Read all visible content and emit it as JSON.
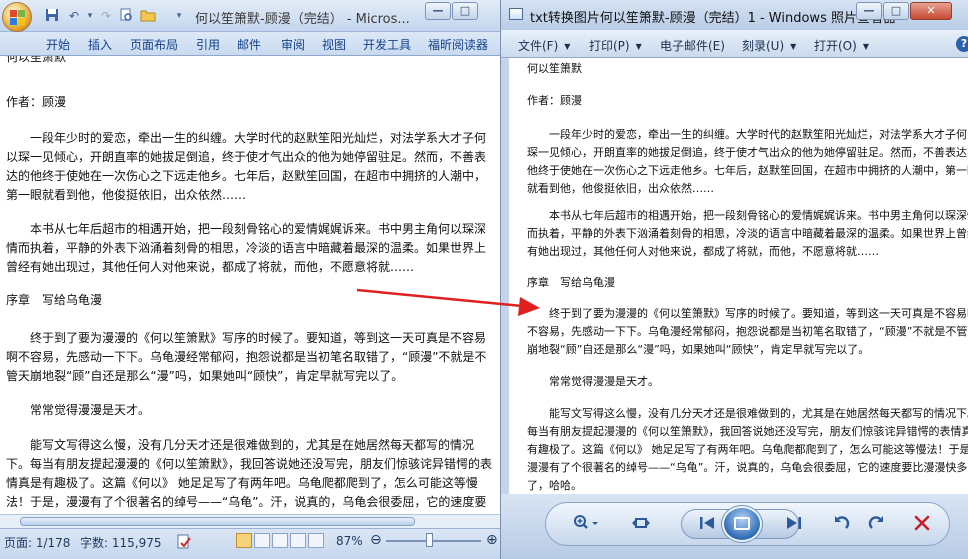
{
  "word": {
    "title": "何以笙箫默-顾漫（完结） - Micros...",
    "tabs": [
      "开始",
      "插入",
      "页面布局",
      "引用",
      "邮件",
      "审阅",
      "视图",
      "开发工具",
      "福昕阅读器"
    ],
    "doc": {
      "title_line": "何以笙箫默",
      "author_line": "作者：顾漫",
      "para1": "一段年少时的爱恋，牵出一生的纠缠。大学时代的赵默笙阳光灿烂，对法学系大才子何以琛一见倾心，开朗直率的她拔足倒追，终于使才气出众的他为她停留驻足。然而，不善表达的他终于使她在一次伤心之下远走他乡。七年后，赵默笙回国，在超市中拥挤的人潮中，第一眼就看到他，他俊挺依旧，出众依然……",
      "para2": "本书从七年后超市的相遇开始，把一段刻骨铭心的爱情娓娓诉来。书中男主角何以琛深情而执着，平静的外表下汹涌着刻骨的相思，冷淡的语言中暗藏着最深的温柔。如果世界上曾经有她出现过，其他任何人对他来说，都成了将就，而他，不愿意将就……",
      "chapter": "序章　写给乌龟漫",
      "para3": "终于到了要为漫漫的《何以笙箫默》写序的时候了。要知道，等到这一天可真是不容易啊不容易，先感动一下下。乌龟漫经常郁闷，抱怨说都是当初笔名取错了，“顾漫”不就是不管天崩地裂“顾”自还是那么“漫”吗，如果她叫“顾快”，肯定早就写完以了。",
      "para4": "常常觉得漫漫是天才。",
      "para5": "能写文写得这么慢，没有几分天才还是很难做到的，尤其是在她居然每天都写的情况下。每当有朋友提起漫漫的《何以笙箫默》，我回答说她还没写完，朋友们惊骇诧异错愕的表情真是有趣极了。这篇《何以》 她足足写了有两年吧。乌龟爬都爬到了，怎么可能这等慢法！于是，漫漫有了个很著名的绰号——“乌龟”。汗，说真的，乌龟会很委屈，它的速度要比漫漫快多了"
    },
    "status": {
      "page": "页面: 1/178",
      "words": "字数: 115,975",
      "zoom": "87%"
    }
  },
  "viewer": {
    "title": "txt转换图片何以笙箫默-顾漫（完结）1 - Windows 照片查看器",
    "menus": [
      "文件(F)",
      "打印(P)",
      "电子邮件(E)",
      "刻录(U)",
      "打开(O)"
    ],
    "help": "?",
    "text": {
      "title_line": "何以笙箫默",
      "author_line": "作者：顾漫",
      "para1": "一段年少时的爱恋，牵出一生的纠缠。大学时代的赵默笙阳光灿烂，对法学系大才子何以琛一见倾心，开朗直率的她拔足倒追，终于使才气出众的他为她停留驻足。然而，不善表达的他终于使她在一次伤心之下远走他乡。七年后，赵默笙回国，在超市中拥挤的人潮中，第一眼就看到他，他俊挺依旧，出众依然……",
      "para2": "本书从七年后超市的相遇开始，把一段刻骨铭心的爱情娓娓诉来。书中男主角何以琛深情而执着，平静的外表下汹涌着刻骨的相思，冷淡的语言中暗藏着最深的温柔。如果世界上曾经有她出现过，其他任何人对他来说，都成了将就，而他，不愿意将就……",
      "chapter": "序章　写给乌龟漫",
      "para3": "终于到了要为漫漫的《何以笙箫默》写序的时候了。要知道，等到这一天可真是不容易啊不容易，先感动一下下。乌龟漫经常郁闷，抱怨说都是当初笔名取错了，“顾漫”不就是不管天崩地裂“顾”自还是那么“漫”吗，如果她叫“顾快”，肯定早就写完以了。",
      "para4": "常常觉得漫漫是天才。",
      "para5": "能写文写得这么慢，没有几分天才还是很难做到的，尤其是在她居然每天都写的情况下。每当有朋友提起漫漫的《何以笙箫默》，我回答说她还没写完，朋友们惊骇诧异错愕的表情真是有趣极了。这篇《何以》 她足足写了有两年吧。乌龟爬都爬到了，怎么可能这等慢法！于是，漫漫有了个很著名的绰号——“乌龟”。汗，说真的，乌龟会很委屈，它的速度要比漫漫快多了，哈哈。"
    }
  },
  "icons": {
    "zoom": "zoom-icon",
    "fit": "actual-size-icon",
    "prev": "previous-icon",
    "next": "next-icon",
    "rotate_ccw": "rotate-counterclockwise-icon",
    "rotate_cw": "rotate-clockwise-icon",
    "delete": "delete-icon"
  },
  "colors": {
    "annotation_arrow": "#e02020",
    "delete_red": "#c8202a"
  }
}
